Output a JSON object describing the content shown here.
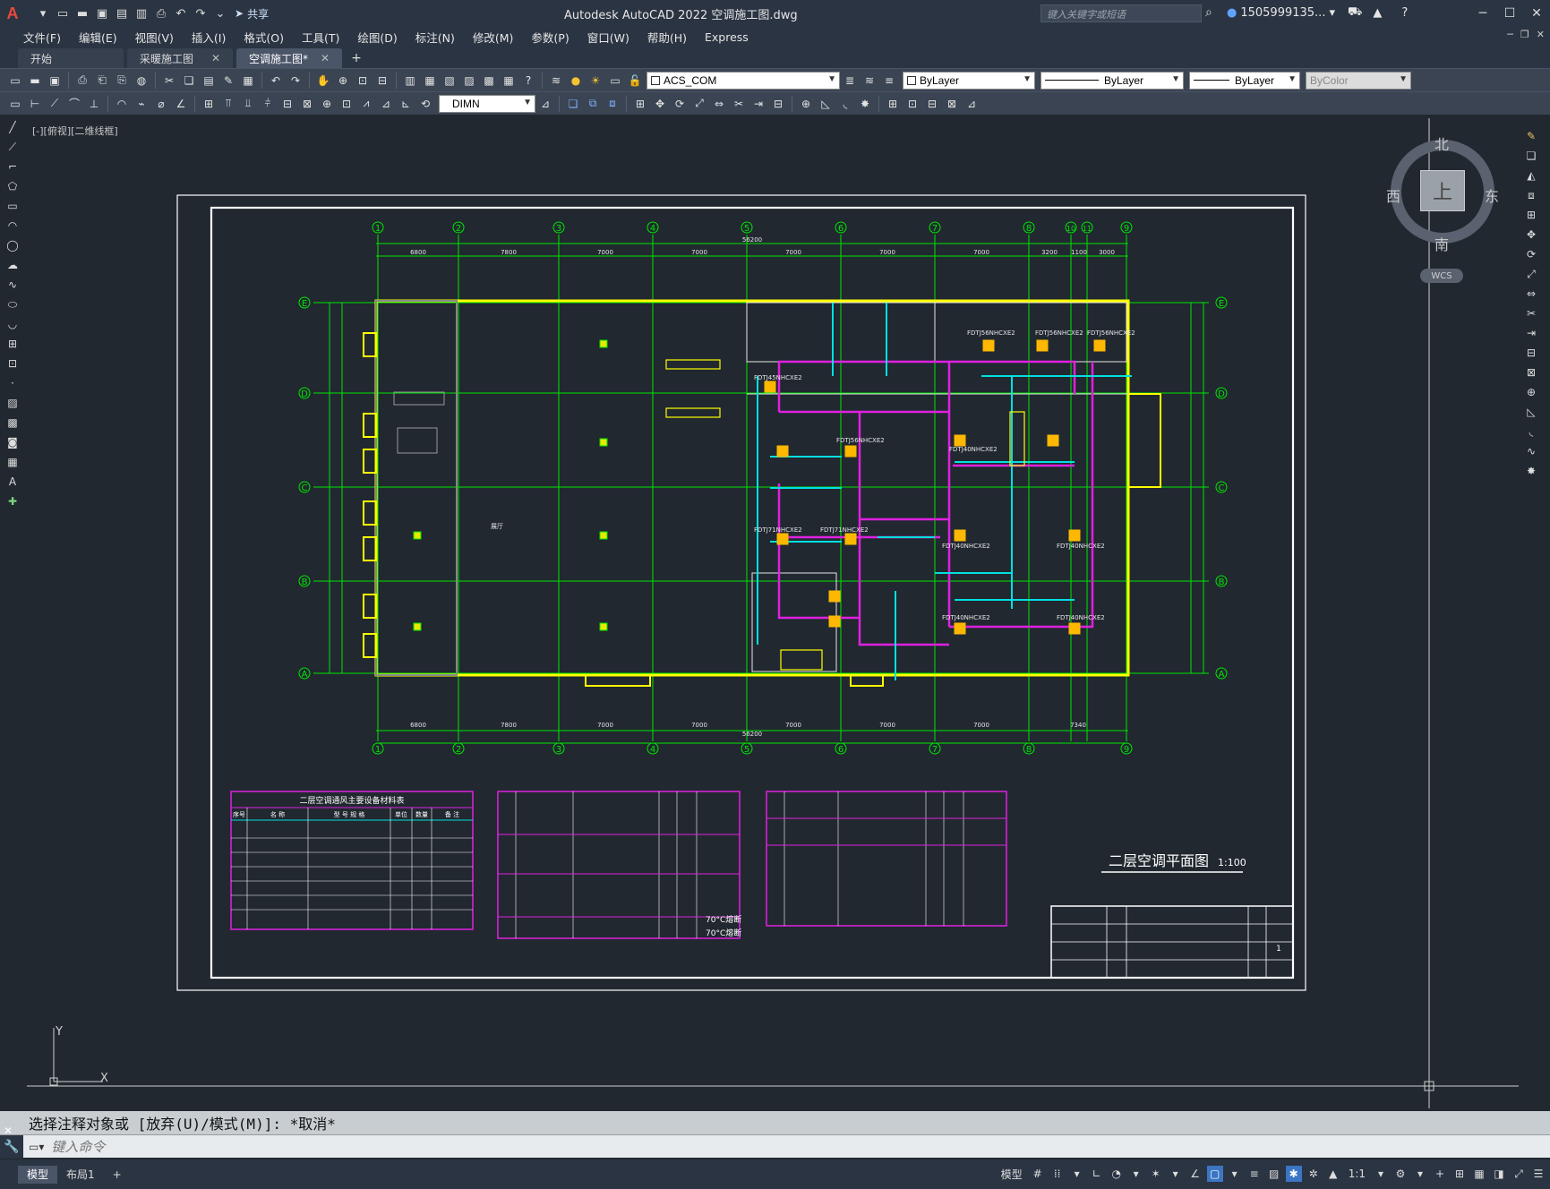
{
  "app": {
    "logo": "A",
    "title": "Autodesk AutoCAD 2022    空调施工图.dwg",
    "share_label": "共享",
    "search_placeholder": "键入关键字或短语",
    "user": "1505999135...",
    "window_controls": [
      "minimize-icon",
      "maximize-icon",
      "close-icon"
    ]
  },
  "menu": [
    "文件(F)",
    "编辑(E)",
    "视图(V)",
    "插入(I)",
    "格式(O)",
    "工具(T)",
    "绘图(D)",
    "标注(N)",
    "修改(M)",
    "参数(P)",
    "窗口(W)",
    "帮助(H)",
    "Express"
  ],
  "tabs": [
    {
      "label": "开始",
      "active": false,
      "closable": false
    },
    {
      "label": "采暖施工图",
      "active": false,
      "closable": true
    },
    {
      "label": "空调施工图*",
      "active": true,
      "closable": true
    }
  ],
  "toolbar": {
    "layer_combo": "ACS_COM",
    "color_combo": "ByLayer",
    "linetype_combo": "ByLayer",
    "lineweight_combo": "ByLayer",
    "plotstyle_combo": "ByColor",
    "dimstyle_combo": "DIMN"
  },
  "viewport_label": "[-][俯视][二维线框]",
  "viewcube": {
    "north": "北",
    "south": "南",
    "east": "东",
    "west": "西",
    "face": "上",
    "wcs": "WCS"
  },
  "drawing": {
    "title": "二层空调平面图",
    "scale": "1:100",
    "grid_columns": [
      "1",
      "2",
      "3",
      "4",
      "5",
      "6",
      "7",
      "8",
      "10",
      "11",
      "9"
    ],
    "grid_rows": [
      "E",
      "D",
      "C",
      "B",
      "A"
    ],
    "dim_top": [
      "6800",
      "7800",
      "7000",
      "7000",
      "7000",
      "7000",
      "7000",
      "3200",
      "1100",
      "3000"
    ],
    "dim_overall": "56200",
    "dim_bottom": [
      "6800",
      "7800",
      "7000",
      "7000",
      "7000",
      "7000",
      "7000",
      "7340"
    ],
    "equipment_labels": [
      "FDTJ56NHCXE2",
      "FDTJ56NHCXE2",
      "FDTJ56NHCXE2",
      "FDTJ45NHCXE2",
      "FDTJ40NHCXE2",
      "FDTJ40NHCXE2",
      "FDTJ40NHCXE2",
      "FDTJ40NHCXE2",
      "FDTJ40NHCXE2",
      "FDTJ71NHCXE2",
      "FDTJ71NHCXE2",
      "FDTJ56NHCXE2"
    ],
    "room_label": "展厅",
    "table1_title": "二层空调通风主要设备材料表",
    "table1_headers": [
      "序号",
      "名 称",
      "型 号 规 格",
      "单位",
      "数量",
      "备 注"
    ],
    "temp_label_1": "70°C熔断",
    "temp_label_2": "70°C熔断",
    "title_block_sheet": "1"
  },
  "command": {
    "history": "选择注释对象或 [放弃(U)/模式(M)]: *取消*",
    "placeholder": "键入命令"
  },
  "status": {
    "layout_tabs": [
      "模型",
      "布局1"
    ],
    "model_label": "模型",
    "scale_label": "1:1"
  }
}
